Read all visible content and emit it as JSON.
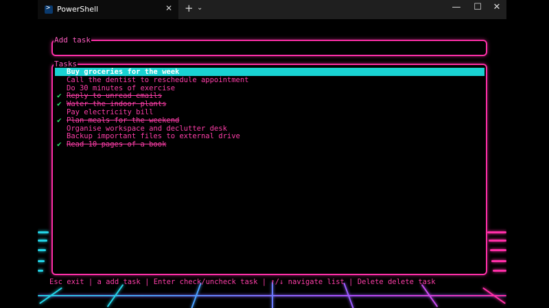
{
  "window": {
    "tab_title": "PowerShell",
    "tab_close": "✕",
    "new_tab": "+",
    "tab_dropdown": "⌄",
    "minimize": "—",
    "maximize": "☐",
    "close": "✕"
  },
  "add_task": {
    "title": "Add task",
    "value": ""
  },
  "tasks": {
    "title": "Tasks",
    "items": [
      {
        "label": "Buy groceries for the week",
        "done": false,
        "selected": true
      },
      {
        "label": "Call the dentist to reschedule appointment",
        "done": false,
        "selected": false
      },
      {
        "label": "Do 30 minutes of exercise",
        "done": false,
        "selected": false
      },
      {
        "label": "Reply to unread emails",
        "done": true,
        "selected": false
      },
      {
        "label": "Water the indoor plants",
        "done": true,
        "selected": false
      },
      {
        "label": "Pay electricity bill",
        "done": false,
        "selected": false
      },
      {
        "label": "Plan meals for the weekend",
        "done": true,
        "selected": false
      },
      {
        "label": "Organise workspace and declutter desk",
        "done": false,
        "selected": false
      },
      {
        "label": "Backup important files to external drive",
        "done": false,
        "selected": false
      },
      {
        "label": "Read 10 pages of a book",
        "done": true,
        "selected": false
      }
    ]
  },
  "footer": {
    "help": "Esc exit | a add task | Enter check/uncheck task | ↑/↓ navigate list | Delete delete task"
  },
  "colors": {
    "accent": "#ff2fa8",
    "text": "#ff3ea9",
    "selection": "#19d2d2",
    "check": "#2ee06a",
    "cyan_neon": "#23d3e6",
    "violet_neon": "#8a5cff"
  }
}
